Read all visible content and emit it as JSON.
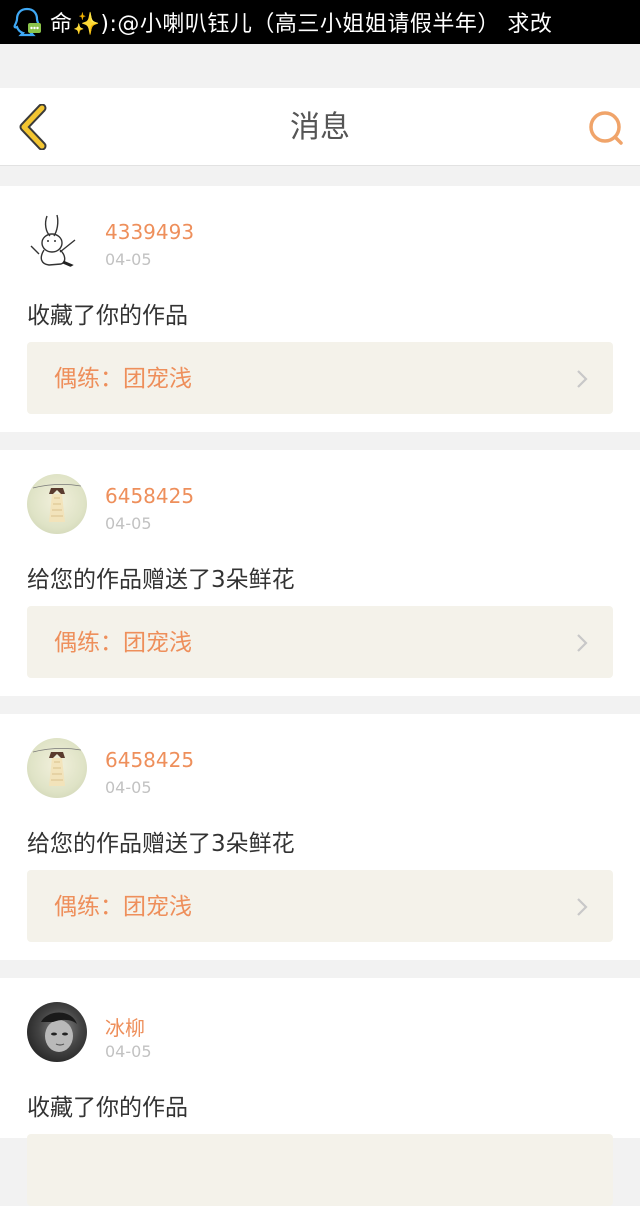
{
  "status_bar": {
    "notification_text": "命✨):@小喇叭钰儿（高三小姐姐请假半年） 求改"
  },
  "header": {
    "title": "消息",
    "back_icon": "chevron-left-icon",
    "search_icon": "search-icon"
  },
  "colors": {
    "accent": "#ee8f5b",
    "back_yellow": "#f3c531",
    "card_link_bg": "#f4f2ea"
  },
  "messages": [
    {
      "username": "4339493",
      "date": "04-05",
      "text": "收藏了你的作品",
      "work": "偶练：团宠浅",
      "avatar": "rabbit-sketch"
    },
    {
      "username": "6458425",
      "date": "04-05",
      "text": "给您的作品赠送了3朵鲜花",
      "work": "偶练：团宠浅",
      "avatar": "dress-photo"
    },
    {
      "username": "6458425",
      "date": "04-05",
      "text": "给您的作品赠送了3朵鲜花",
      "work": "偶练：团宠浅",
      "avatar": "dress-photo"
    },
    {
      "username": "冰柳",
      "date": "04-05",
      "text": "收藏了你的作品",
      "work": "",
      "avatar": "face-photo"
    }
  ]
}
